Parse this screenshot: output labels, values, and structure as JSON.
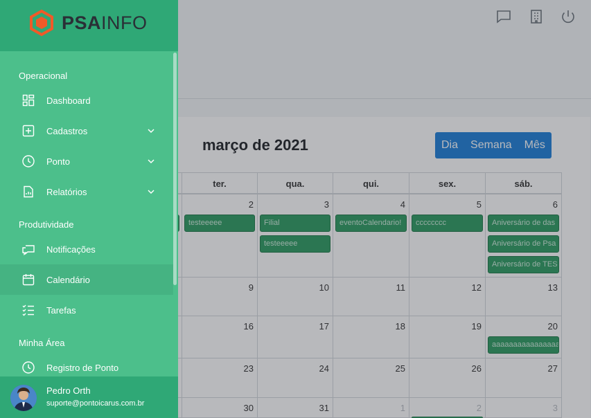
{
  "brand": {
    "name_bold": "PSA",
    "name_light": "INFO",
    "logo_color": "#f05a28"
  },
  "sidebar": {
    "sections": [
      {
        "title": "Operacional"
      },
      {
        "title": "Produtividade"
      },
      {
        "title": "Minha Área"
      }
    ],
    "items": [
      {
        "label": "Dashboard",
        "icon": "dashboard-icon"
      },
      {
        "label": "Cadastros",
        "icon": "plus-square-icon",
        "expandable": true
      },
      {
        "label": "Ponto",
        "icon": "clock-icon",
        "expandable": true
      },
      {
        "label": "Relatórios",
        "icon": "report-icon",
        "expandable": true
      },
      {
        "label": "Notificações",
        "icon": "chat-icon"
      },
      {
        "label": "Calendário",
        "icon": "calendar-icon",
        "active": true
      },
      {
        "label": "Tarefas",
        "icon": "checklist-icon"
      },
      {
        "label": "Registro de Ponto",
        "icon": "clock-icon"
      }
    ],
    "user": {
      "name": "Pedro Orth",
      "email": "suporte@pontoicarus.com.br"
    }
  },
  "topbar": {
    "icons": [
      "chat-icon",
      "building-icon",
      "power-icon"
    ]
  },
  "calendar": {
    "title": "março de 2021",
    "views": [
      "Dia",
      "Semana",
      "Mês"
    ],
    "weekdays": [
      "ter.",
      "qua.",
      "qui.",
      "sex.",
      "sáb."
    ],
    "weeks": [
      [
        "2",
        "3",
        "4",
        "5",
        "6"
      ],
      [
        "9",
        "10",
        "11",
        "12",
        "13"
      ],
      [
        "16",
        "17",
        "18",
        "19",
        "20"
      ],
      [
        "23",
        "24",
        "25",
        "26",
        "27"
      ],
      [
        "30",
        "31",
        "1",
        "2",
        "3"
      ]
    ],
    "events": {
      "w0": [
        "testeeeee",
        "Filial",
        "testeeeee",
        "eventoCalendario!",
        "cccccccc",
        "Aniversário de das",
        "Aniversário de Psa",
        "Aniversário de TES"
      ],
      "w2": [
        "aaaaaaaaaaaaaaaaa"
      ]
    },
    "event_color": "#2e9b62",
    "accent": "#1e7fd8"
  }
}
